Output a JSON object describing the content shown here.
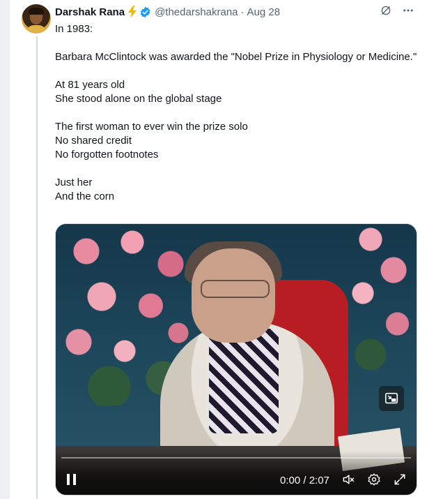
{
  "tweet": {
    "author_name": "Darshak Rana",
    "handle": "@thedarshakrana",
    "separator": "·",
    "date": "Aug 28",
    "lines": [
      "In 1983:",
      "",
      "Barbara McClintock was awarded the \"Nobel Prize in Physiology or Medicine.\"",
      "",
      "At 81 years old",
      "She stood alone on the global stage",
      "",
      "The first woman to ever win the prize solo",
      "No shared credit",
      "No forgotten footnotes",
      "",
      "Just her",
      "And the corn"
    ]
  },
  "icons": {
    "badge": "lightning-bolt-icon",
    "verified": "verified-badge-icon",
    "grok": "grok-icon",
    "more": "more-options-icon"
  },
  "video": {
    "time_display": "0:00 / 2:07",
    "progress": 0.0
  },
  "colors": {
    "accent": "#1d9bf0",
    "bolt": "#f5b800",
    "text": "#0f1419",
    "muted": "#536471"
  }
}
